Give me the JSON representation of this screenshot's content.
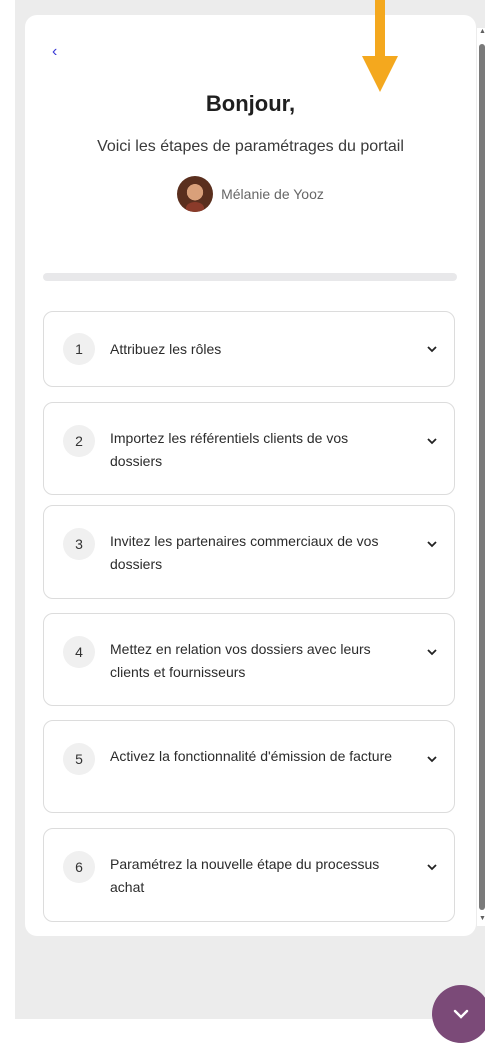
{
  "header": {
    "back_glyph": "‹",
    "title": "Bonjour,",
    "subtitle": "Voici les étapes de paramétrages du portail",
    "user_name": "Mélanie de Yooz"
  },
  "progress": {
    "value": 0
  },
  "steps": [
    {
      "number": "1",
      "label": "Attribuez les rôles"
    },
    {
      "number": "2",
      "label": "Importez les référentiels clients de vos dossiers"
    },
    {
      "number": "3",
      "label": "Invitez les partenaires commerciaux de vos dossiers"
    },
    {
      "number": "4",
      "label": "Mettez en relation vos dossiers avec leurs clients et fournisseurs"
    },
    {
      "number": "5",
      "label": "Activez la fonctionnalité d'émission de facture"
    },
    {
      "number": "6",
      "label": "Paramétrez la nouvelle étape du processus achat"
    }
  ],
  "icons": {
    "back": "chevron-left-icon",
    "step_toggle": "chevron-down-icon",
    "fab": "chevron-down-icon",
    "pointer": "arrow-down-icon"
  },
  "colors": {
    "accent": "#3b3bd6",
    "fab": "#7b4a78",
    "pointer_arrow": "#f4a81e",
    "backdrop": "#ececec"
  }
}
